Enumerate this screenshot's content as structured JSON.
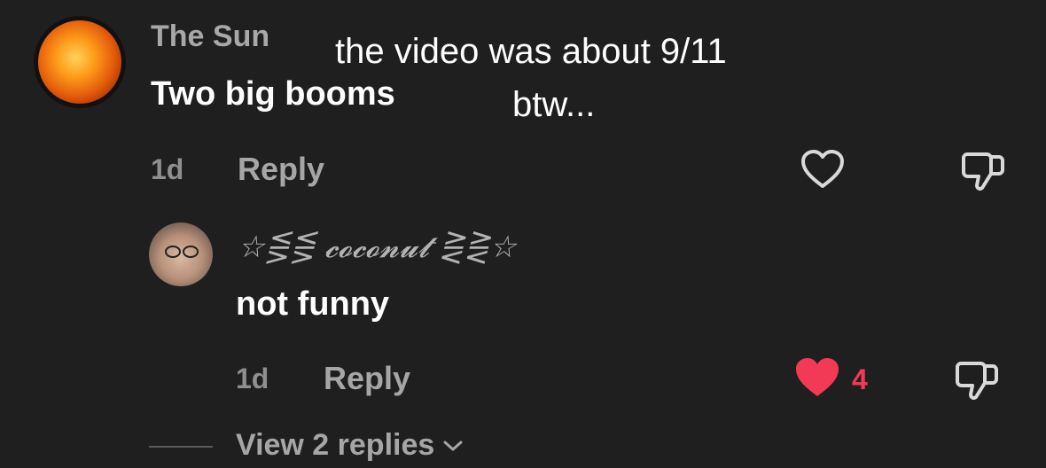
{
  "overlay": {
    "line1": "the video was about 9/11",
    "line2": "btw..."
  },
  "comment": {
    "username": "The Sun",
    "text": "Two big booms",
    "age": "1d",
    "reply_label": "Reply"
  },
  "reply_comment": {
    "username": "☆⋚⋚ 𝓬𝓸𝓬𝓸𝓷𝓾𝓽 ⋛⋛☆",
    "text": "not funny",
    "age": "1d",
    "reply_label": "Reply",
    "like_count": "4"
  },
  "thread": {
    "view_replies_label": "View 2 replies"
  },
  "colors": {
    "background": "#1f1f1f",
    "like_active": "#f23a56",
    "muted": "#a6a6a6"
  }
}
